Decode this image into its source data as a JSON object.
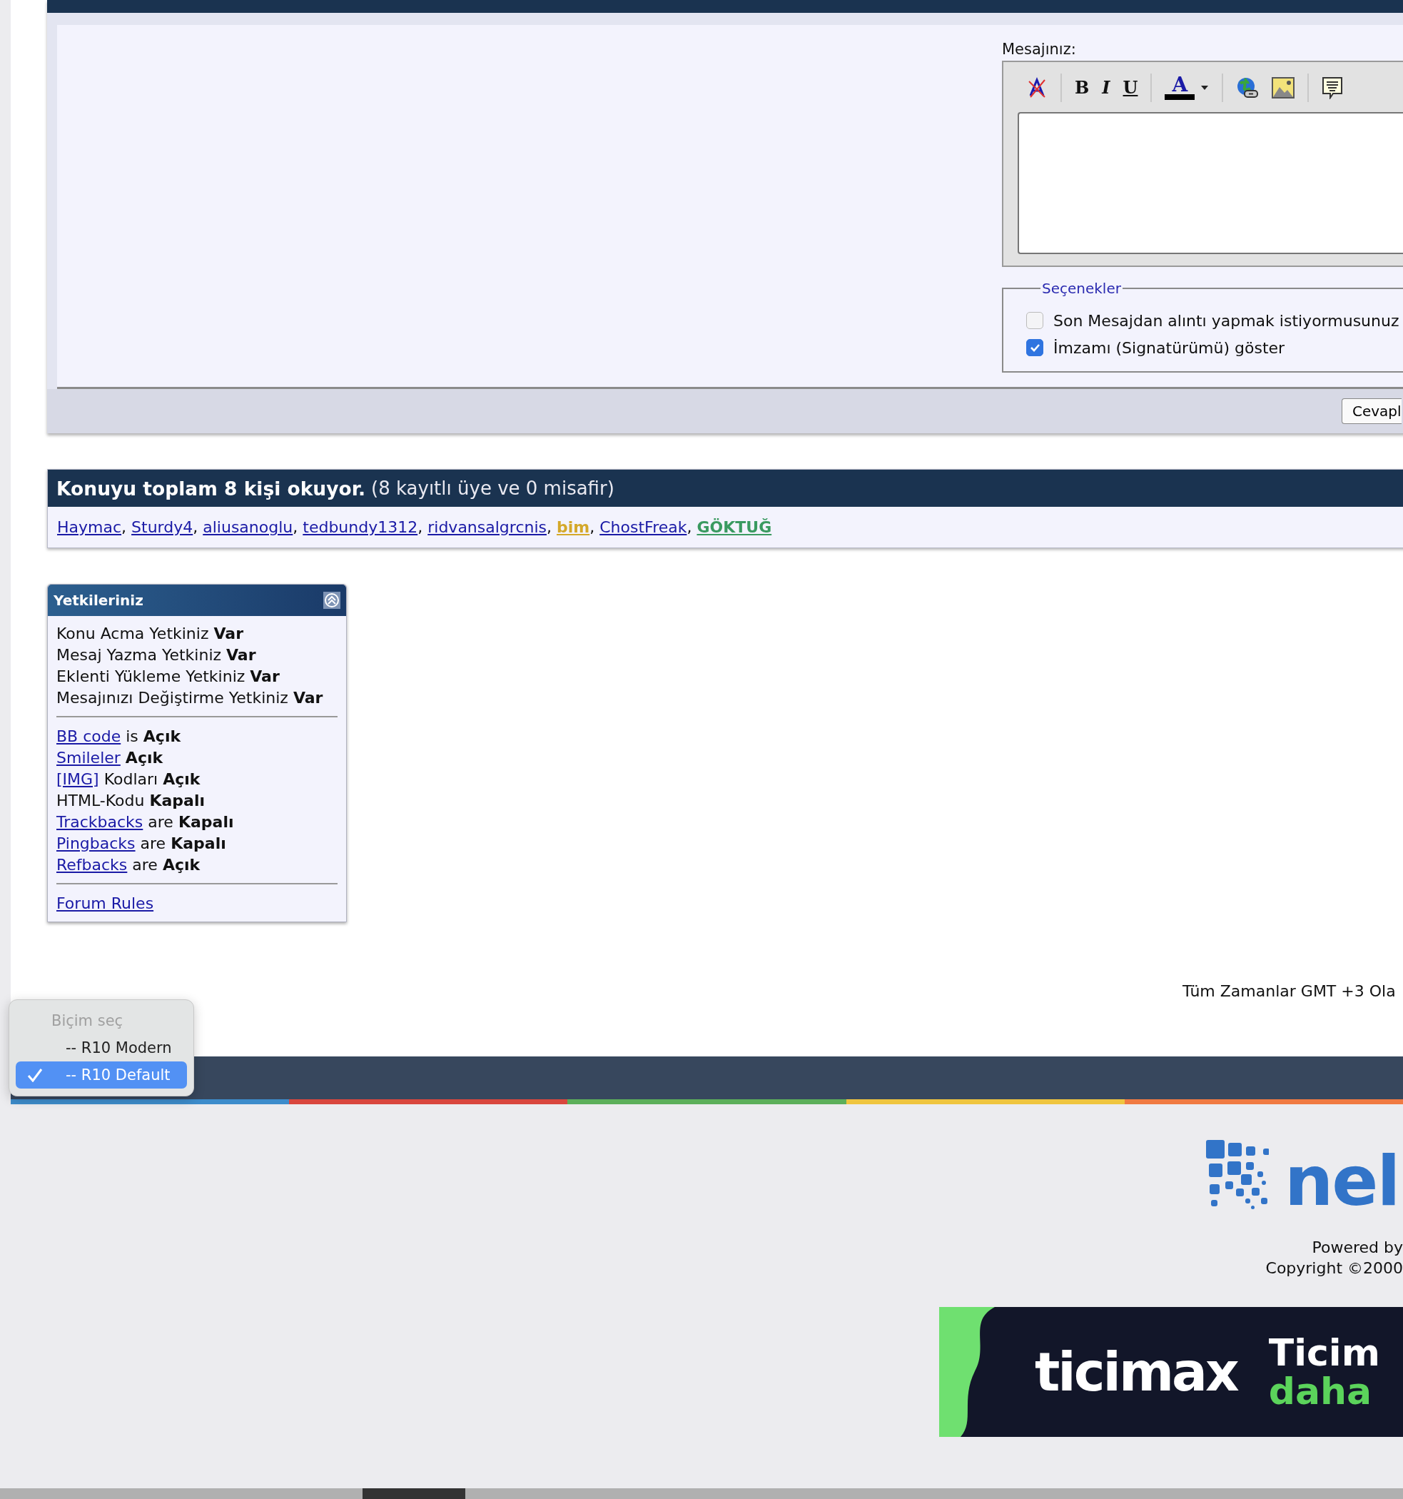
{
  "quick_reply": {
    "message_label": "Mesajınız:",
    "toolbar": [
      {
        "kind": "clear"
      },
      {
        "kind": "separator"
      },
      {
        "kind": "bold",
        "label": "B"
      },
      {
        "kind": "italic",
        "label": "I"
      },
      {
        "kind": "underline",
        "label": "U"
      },
      {
        "kind": "separator"
      },
      {
        "kind": "color",
        "label": "A"
      },
      {
        "kind": "separator"
      },
      {
        "kind": "link"
      },
      {
        "kind": "image"
      },
      {
        "kind": "separator"
      },
      {
        "kind": "quote"
      }
    ],
    "options_legend": "Seçenekler",
    "options": [
      {
        "label": "Son Mesajdan alıntı yapmak istiyormusunuz",
        "checked": false
      },
      {
        "label": "İmzamı (Signatürümü) göster",
        "checked": true
      }
    ],
    "submit_button": "Cevapl"
  },
  "readers": {
    "title": "Konuyu toplam 8 kişi okuyor.",
    "subtitle": "(8 kayıtlı üye ve 0 misafir)",
    "users": [
      {
        "name": "Haymac",
        "color": "#1a1aa6",
        "bold": false,
        "separator": ","
      },
      {
        "name": "Sturdy4",
        "color": "#1a1aa6",
        "bold": false,
        "separator": ","
      },
      {
        "name": "aliusanoglu",
        "color": "#1a1aa6",
        "bold": false,
        "separator": ","
      },
      {
        "name": "tedbundy1312",
        "color": "#1a1aa6",
        "bold": false,
        "separator": ","
      },
      {
        "name": "ridvansalgrcnis",
        "color": "#1a1aa6",
        "bold": false,
        "separator": ","
      },
      {
        "name": "bim",
        "color": "#d4a82a",
        "bold": true,
        "separator": ","
      },
      {
        "name": "ChostFreak",
        "color": "#1a1aa6",
        "bold": false,
        "separator": ","
      },
      {
        "name": "GÖKTUĞ",
        "color": "#3a9a60",
        "bold": true
      }
    ]
  },
  "permissions": {
    "title": "Yetkileriniz",
    "groups": [
      [
        {
          "text": "Konu Acma Yetkiniz **Var**"
        },
        {
          "text": "Mesaj Yazma Yetkiniz **Var**"
        },
        {
          "text": "Eklenti Yükleme Yetkiniz **Var**"
        },
        {
          "text": "Mesajınızı Değiştirme Yetkiniz **Var**"
        }
      ],
      [
        {
          "link": "BB code",
          "text": "is **Açık**"
        },
        {
          "link": "Smileler",
          "text": "**Açık**"
        },
        {
          "link": "[IMG]",
          "text": "Kodları **Açık**"
        },
        {
          "text": "HTML-Kodu **Kapalı**"
        },
        {
          "link": "Trackbacks",
          "text": "are **Kapalı**"
        },
        {
          "link": "Pingbacks",
          "text": "are **Kapalı**"
        },
        {
          "link": "Refbacks",
          "text": "are **Açık**"
        }
      ],
      [
        {
          "link": "Forum Rules"
        }
      ]
    ]
  },
  "timezone_note": "Tüm Zamanlar GMT +3 Ola",
  "style_menu": {
    "heading": "Biçim seç",
    "items": [
      {
        "label": "-- R10 Modern",
        "selected": false
      },
      {
        "label": "-- R10 Default",
        "selected": true
      }
    ]
  },
  "footer": {
    "logo_text": "nel",
    "powered_by": "Powered by",
    "copyright": "Copyright ©2000",
    "banner": {
      "brand": "ticimax",
      "headline": "Ticim",
      "tagline": "daha"
    }
  }
}
